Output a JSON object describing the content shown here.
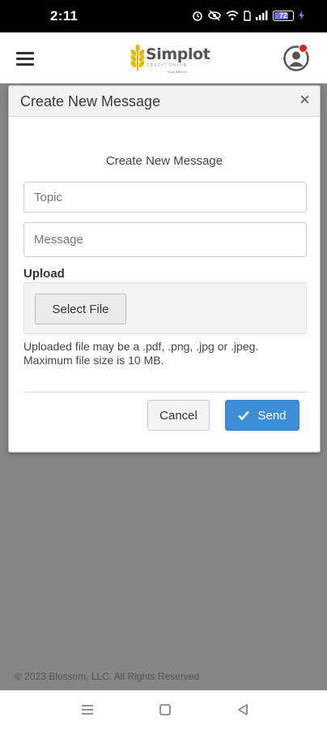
{
  "status_bar": {
    "time": "2:11",
    "battery": "72"
  },
  "header": {
    "logo_name": "Simplot",
    "logo_subtitle": "CREDIT UNION",
    "logo_tagline": "Grow With Us"
  },
  "modal": {
    "title": "Create New Message",
    "close_glyph": "×",
    "form_heading": "Create New Message",
    "topic_placeholder": "Topic",
    "message_placeholder": "Message",
    "upload_label": "Upload",
    "select_file_label": "Select File",
    "upload_note_line1": "Uploaded file may be a .pdf, .png, .jpg or .jpeg.",
    "upload_note_line2": "Maximum file size is 10 MB.",
    "cancel_label": "Cancel",
    "send_label": "Send"
  },
  "footer": {
    "copyright": "© 2023 Blossom, LLC. All Rights Reserved"
  },
  "colors": {
    "accent": "#3c8ed6",
    "notification": "#e02020",
    "logo_gold": "#e6b800",
    "overlay": "#858585"
  },
  "icons": [
    "alarm-icon",
    "eye-off-icon",
    "wifi-icon",
    "sim-icon",
    "signal-icon",
    "battery-icon",
    "charging-icon",
    "menu-icon",
    "user-avatar-icon",
    "close-icon",
    "check-icon",
    "nav-menu-icon",
    "nav-home-icon",
    "nav-back-icon"
  ]
}
